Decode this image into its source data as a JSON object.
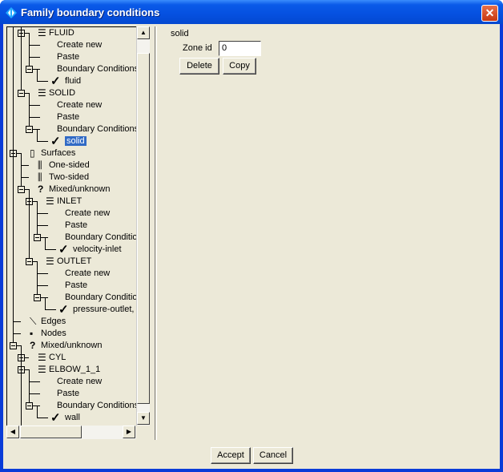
{
  "window": {
    "title": "Family boundary conditions",
    "close": "✕"
  },
  "tree": [
    {
      "label": "FLUID",
      "level": 1,
      "exp": "-",
      "icon": "family"
    },
    {
      "label": "Create new",
      "level": 2
    },
    {
      "label": "Paste",
      "level": 2
    },
    {
      "label": "Boundary Conditions",
      "level": 2,
      "exp": "-"
    },
    {
      "label": "fluid",
      "level": 3,
      "icon": "check"
    },
    {
      "label": "SOLID",
      "level": 1,
      "exp": "-",
      "icon": "family"
    },
    {
      "label": "Create new",
      "level": 2
    },
    {
      "label": "Paste",
      "level": 2
    },
    {
      "label": "Boundary Conditions",
      "level": 2,
      "exp": "-"
    },
    {
      "label": "solid",
      "level": 3,
      "icon": "check",
      "selected": true
    },
    {
      "label": "Surfaces",
      "level": 0,
      "exp": "-",
      "icon": "surface"
    },
    {
      "label": "One-sided",
      "level": 1,
      "icon": "one-sided"
    },
    {
      "label": "Two-sided",
      "level": 1,
      "icon": "two-sided"
    },
    {
      "label": "Mixed/unknown",
      "level": 1,
      "exp": "-",
      "icon": "question"
    },
    {
      "label": "INLET",
      "level": 2,
      "exp": "-",
      "icon": "family"
    },
    {
      "label": "Create new",
      "level": 3
    },
    {
      "label": "Paste",
      "level": 3
    },
    {
      "label": "Boundary Conditions",
      "level": 3,
      "exp": "-"
    },
    {
      "label": "velocity-inlet",
      "level": 4,
      "icon": "check"
    },
    {
      "label": "OUTLET",
      "level": 2,
      "exp": "-",
      "icon": "family"
    },
    {
      "label": "Create new",
      "level": 3
    },
    {
      "label": "Paste",
      "level": 3
    },
    {
      "label": "Boundary Conditions",
      "level": 3,
      "exp": "-"
    },
    {
      "label": "pressure-outlet, ,",
      "level": 4,
      "icon": "check"
    },
    {
      "label": "Edges",
      "level": 0,
      "icon": "edge"
    },
    {
      "label": "Nodes",
      "level": 0,
      "icon": "node"
    },
    {
      "label": "Mixed/unknown",
      "level": 0,
      "exp": "-",
      "icon": "question"
    },
    {
      "label": "CYL",
      "level": 1,
      "exp": "+",
      "icon": "family"
    },
    {
      "label": "ELBOW_1_1",
      "level": 1,
      "exp": "-",
      "icon": "family"
    },
    {
      "label": "Create new",
      "level": 2
    },
    {
      "label": "Paste",
      "level": 2
    },
    {
      "label": "Boundary Conditions",
      "level": 2,
      "exp": "-"
    },
    {
      "label": "wall",
      "level": 3,
      "icon": "check"
    },
    {
      "label": "",
      "level": 1,
      "icon": "family"
    }
  ],
  "panel": {
    "heading": "solid",
    "zone_label": "Zone id",
    "zone_value": "0",
    "delete": "Delete",
    "copy": "Copy"
  },
  "footer": {
    "accept": "Accept",
    "cancel": "Cancel"
  }
}
